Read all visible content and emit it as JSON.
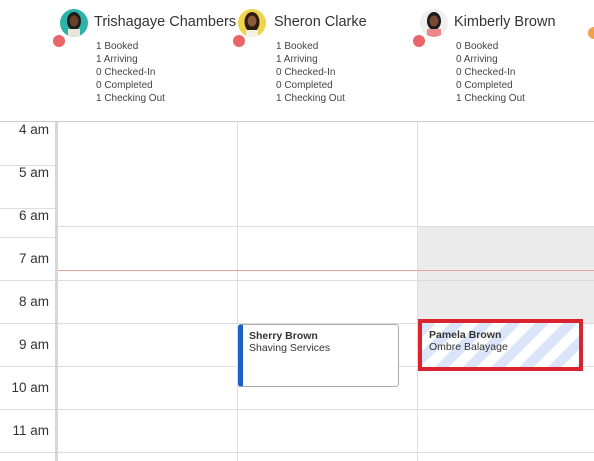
{
  "staff": [
    {
      "name": "Trishagaye Chambers",
      "stats": [
        "1 Booked",
        "1 Arriving",
        "0 Checked-In",
        "0 Completed",
        "1 Checking Out"
      ]
    },
    {
      "name": "Sheron Clarke",
      "stats": [
        "1 Booked",
        "1 Arriving",
        "0 Checked-In",
        "0 Completed",
        "1 Checking Out"
      ]
    },
    {
      "name": "Kimberly Brown",
      "stats": [
        "0 Booked",
        "0 Arriving",
        "0 Checked-In",
        "0 Completed",
        "1 Checking Out"
      ]
    }
  ],
  "times": [
    "4 am",
    "5 am",
    "6 am",
    "7 am",
    "8 am",
    "9 am",
    "10 am",
    "11 am"
  ],
  "appointments": [
    {
      "client": "Sherry Brown",
      "service": "Shaving Services"
    },
    {
      "client": "Pamela Brown",
      "service": "Ombre Balayage"
    }
  ],
  "colors": {
    "status_dot": "#e8666a",
    "appointment_accent": "#1f5fc7",
    "highlight_border": "#d9232e",
    "now_line": "#e8a0a3"
  }
}
